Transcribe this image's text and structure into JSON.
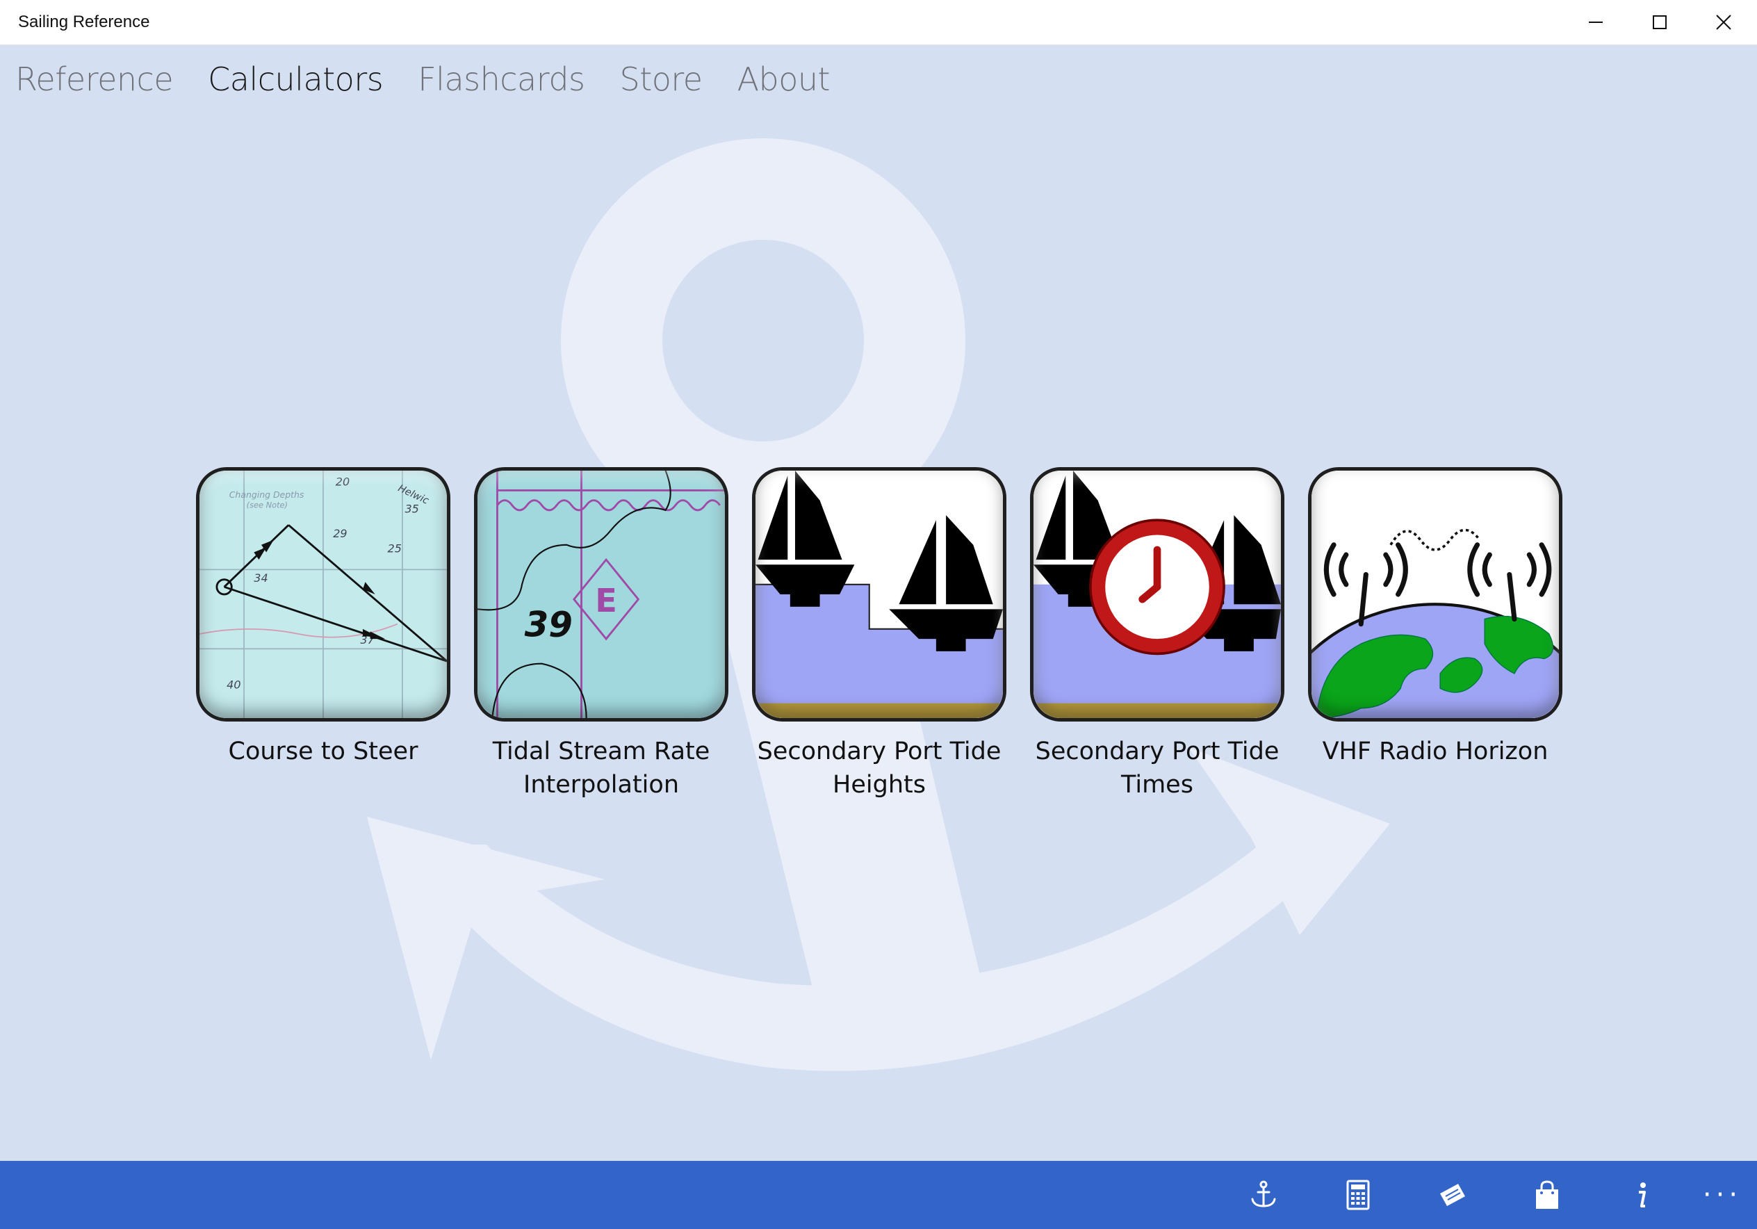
{
  "window": {
    "title": "Sailing Reference"
  },
  "nav": {
    "items": [
      {
        "label": "Reference",
        "active": false
      },
      {
        "label": "Calculators",
        "active": true
      },
      {
        "label": "Flashcards",
        "active": false
      },
      {
        "label": "Store",
        "active": false
      },
      {
        "label": "About",
        "active": false
      }
    ]
  },
  "tiles": [
    {
      "label_line1": "Course to Steer",
      "label_line2": "",
      "icon": "chart-course-icon",
      "chart_numbers": [
        "20",
        "35",
        "29",
        "25",
        "34",
        "37",
        "40"
      ],
      "chart_note_line1": "Changing Depths",
      "chart_note_line2": "(see Note)",
      "chart_place": "Helwic"
    },
    {
      "label_line1": "Tidal Stream Rate",
      "label_line2": "Interpolation",
      "icon": "tidal-diamond-icon",
      "depth": "39",
      "diamond_letter": "E"
    },
    {
      "label_line1": "Secondary Port Tide",
      "label_line2": "Heights",
      "icon": "tide-heights-icon"
    },
    {
      "label_line1": "Secondary Port Tide",
      "label_line2": "Times",
      "icon": "tide-times-icon"
    },
    {
      "label_line1": "VHF Radio Horizon",
      "label_line2": "",
      "icon": "radio-horizon-icon"
    }
  ],
  "colors": {
    "background": "#d5dff2",
    "watermark": "#e9eef9",
    "commandBar": "#3365c8",
    "activeNav": "#1a1a1a",
    "inactiveNav": "#6f7278"
  },
  "commandBar": {
    "buttons": [
      {
        "icon": "anchor-icon",
        "name": "reference"
      },
      {
        "icon": "calculator-icon",
        "name": "calculators"
      },
      {
        "icon": "flashcards-icon",
        "name": "flashcards"
      },
      {
        "icon": "store-bag-icon",
        "name": "store"
      },
      {
        "icon": "info-icon",
        "name": "about"
      }
    ],
    "more_label": "···"
  }
}
